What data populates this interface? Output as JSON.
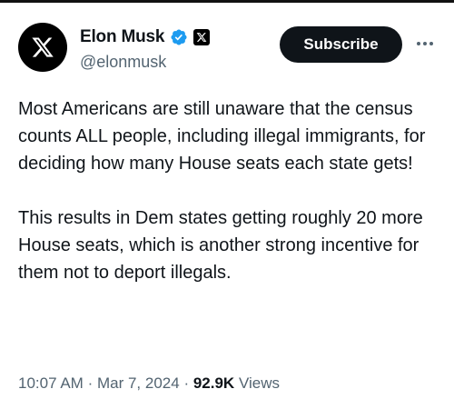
{
  "author": {
    "display_name": "Elon Musk",
    "handle": "@elonmusk",
    "avatar_icon": "x-logo-icon",
    "verified_icon": "verified-badge-icon",
    "affiliation_icon": "x-affiliation-icon",
    "verified_color": "#1d9bf0"
  },
  "actions": {
    "subscribe_label": "Subscribe",
    "more_icon": "more-options-icon"
  },
  "tweet": {
    "paragraphs": [
      "Most Americans are still unaware that the census counts ALL people, including illegal immigrants, for deciding how many House seats each state gets!",
      "This results in Dem states getting roughly 20 more House seats, which is another strong incentive for them not to deport illegals."
    ]
  },
  "meta": {
    "time": "10:07 AM",
    "separator": "·",
    "date": "Mar 7, 2024",
    "views_count": "92.9K",
    "views_label": "Views"
  },
  "colors": {
    "text_primary": "#0f1419",
    "text_secondary": "#536471",
    "button_bg": "#0f1419"
  }
}
